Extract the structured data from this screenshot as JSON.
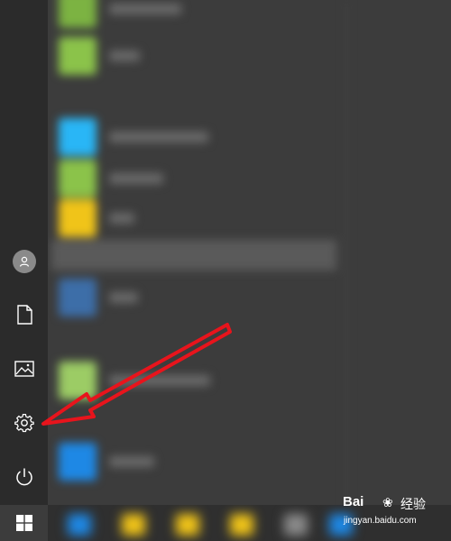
{
  "rail": {
    "items": [
      {
        "id": "account",
        "icon": "user-icon"
      },
      {
        "id": "documents",
        "icon": "document-icon"
      },
      {
        "id": "pictures",
        "icon": "image-icon"
      },
      {
        "id": "settings",
        "icon": "gear-icon"
      },
      {
        "id": "power",
        "icon": "power-icon"
      }
    ],
    "start_icon": "windows-logo-icon"
  },
  "app_list": {
    "tile_colors": [
      "#8bc34a",
      "#29b6f6",
      "#8bc34a",
      "#f0c419",
      "#d9534f",
      "#9ccc65",
      "#1e88e5"
    ]
  },
  "annotation": {
    "arrow_color": "#e8141c",
    "target": "settings"
  },
  "watermark": {
    "brand": "Bai",
    "brand_cn": "经验",
    "url": "jingyan.baidu.com"
  }
}
